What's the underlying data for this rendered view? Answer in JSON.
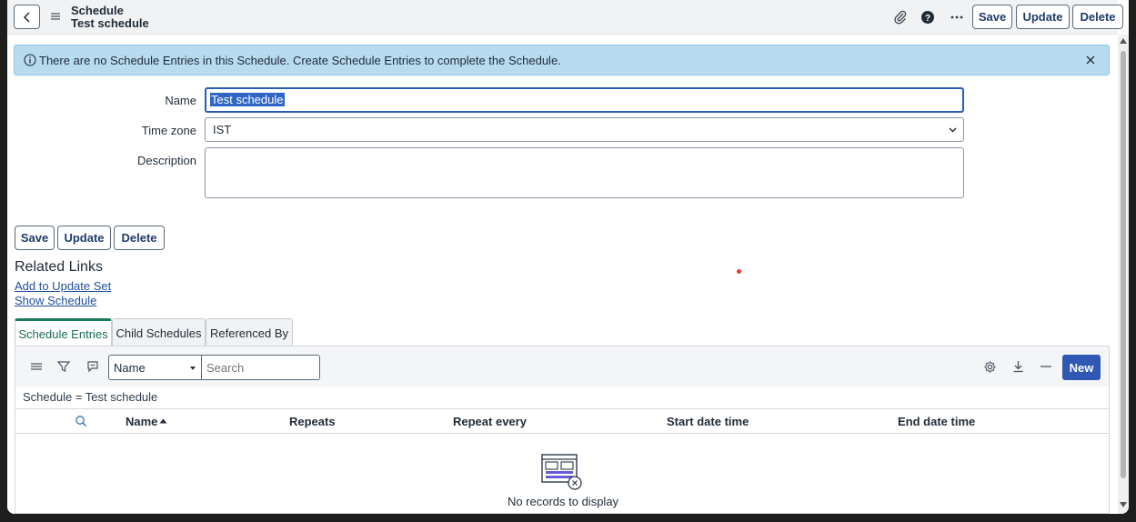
{
  "header": {
    "title": "Schedule",
    "subtitle": "Test schedule",
    "save_label": "Save",
    "update_label": "Update",
    "delete_label": "Delete",
    "icons": [
      "back-icon",
      "menu-icon",
      "paperclip-icon",
      "help-icon",
      "more-icon"
    ]
  },
  "banner": {
    "message": "There are no Schedule Entries in this Schedule. Create Schedule Entries to complete the Schedule."
  },
  "form": {
    "name_label": "Name",
    "name_value": "Test schedule",
    "timezone_label": "Time zone",
    "timezone_value": "IST",
    "description_label": "Description",
    "description_value": ""
  },
  "actions": {
    "save_label": "Save",
    "update_label": "Update",
    "delete_label": "Delete"
  },
  "related_links": {
    "title": "Related Links",
    "links": [
      "Add to Update Set",
      "Show Schedule"
    ]
  },
  "tabs": [
    {
      "label": "Schedule Entries",
      "active": true
    },
    {
      "label": "Child Schedules",
      "active": false
    },
    {
      "label": "Referenced By",
      "active": false
    }
  ],
  "list": {
    "field_select": "Name",
    "search_placeholder": "Search",
    "new_label": "New",
    "condition": "Schedule = Test schedule",
    "columns": [
      "Name",
      "Repeats",
      "Repeat every",
      "Start date time",
      "End date time"
    ],
    "sort_column": "Name",
    "sort_direction": "ascending",
    "empty_message": "No records to display"
  },
  "colors": {
    "banner_bg": "#b8dbf0",
    "primary": "#2f58b5",
    "active_tab": "#1a7a5e"
  }
}
